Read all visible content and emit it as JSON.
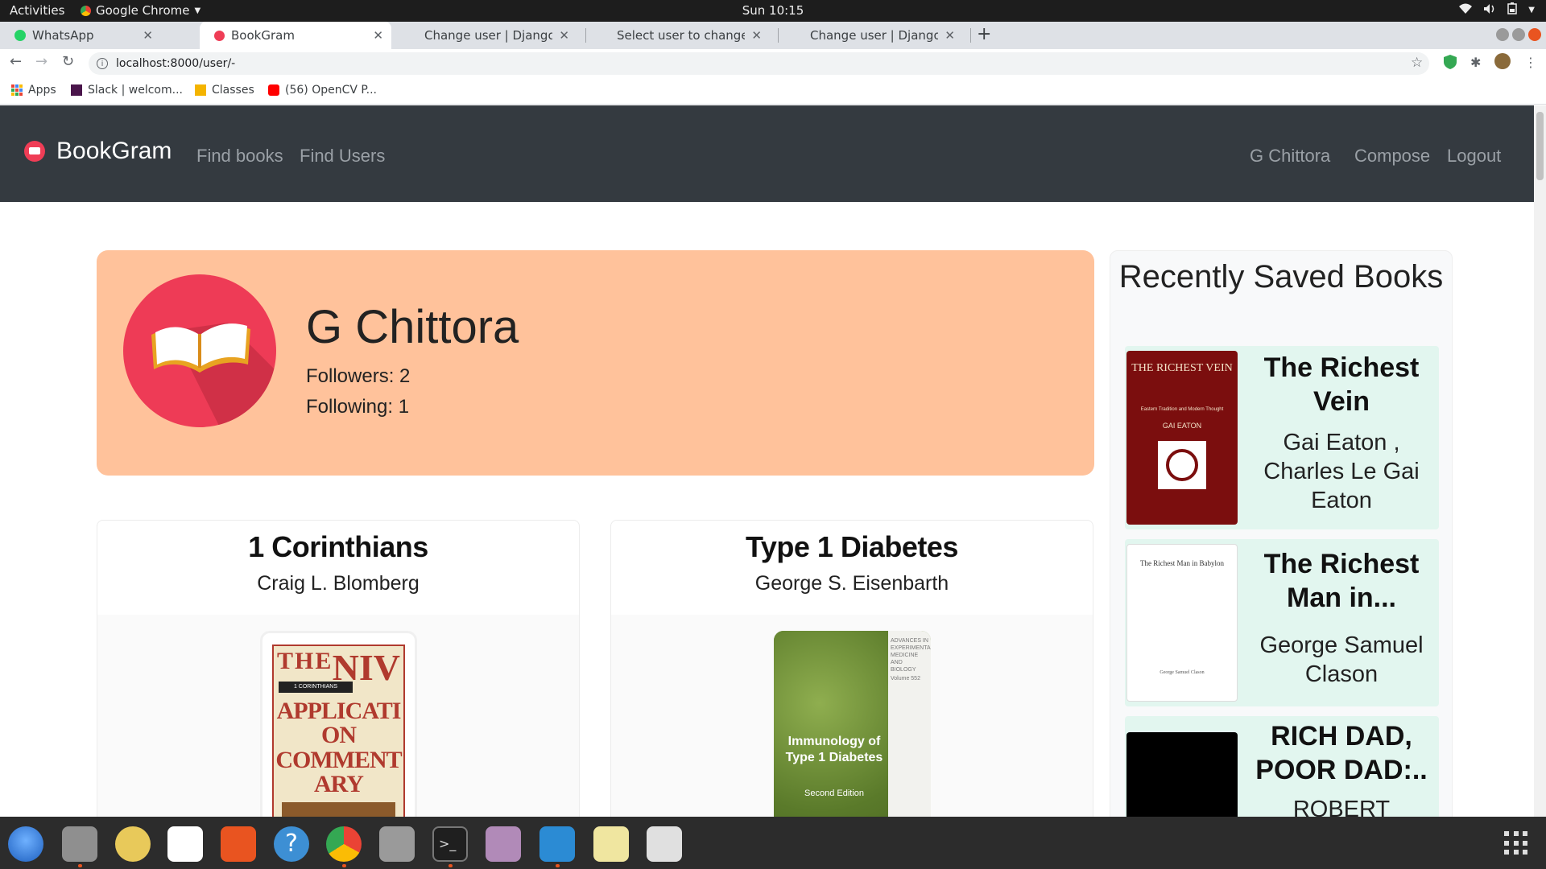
{
  "system": {
    "activities": "Activities",
    "app_name": "Google Chrome",
    "clock": "Sun 10:15"
  },
  "browser": {
    "tabs": [
      {
        "title": "WhatsApp",
        "active": false
      },
      {
        "title": "BookGram",
        "active": true
      },
      {
        "title": "Change user | Django site",
        "active": false
      },
      {
        "title": "Select user to change | Dj",
        "active": false
      },
      {
        "title": "Change user | Django site",
        "active": false
      }
    ],
    "url": "localhost:8000/user/-",
    "bookmarks": [
      "Apps",
      "Slack | welcom...",
      "Classes",
      "(56) OpenCV P..."
    ]
  },
  "navbar": {
    "brand": "BookGram",
    "links": [
      "Find books",
      "Find Users"
    ],
    "right_links": [
      "G Chittora",
      "Compose",
      "Logout"
    ]
  },
  "profile": {
    "name": "G Chittora",
    "followers": "Followers: 2",
    "following": "Following: 1"
  },
  "books": [
    {
      "title": "1 Corinthians",
      "author": "Craig L. Blomberg",
      "cover_icon": "niv-application-commentary-cover",
      "cover_text": [
        "THE",
        "NIV",
        "1 CORINTHIANS",
        "APPLICATION",
        "COMMENTARY"
      ]
    },
    {
      "title": "Type 1 Diabetes",
      "author": "George S. Eisenbarth",
      "cover_icon": "immunology-type1-diabetes-cover",
      "cover_text": [
        "ADVANCES IN EXPERIMENTAL MEDICINE AND BIOLOGY",
        "Volume 552",
        "Immunology of Type 1 Diabetes",
        "Second Edition"
      ]
    }
  ],
  "sidebar": {
    "title": "Recently Saved Books",
    "items": [
      {
        "title": "The Richest Vein",
        "author": "Gai Eaton , Charles Le Gai Eaton",
        "cover_text": [
          "THE RICHEST VEIN",
          "Eastern Tradition and Modern Thought",
          "GAI EATON"
        ]
      },
      {
        "title": "The Richest Man in...",
        "author": "George Samuel Clason",
        "cover_text": [
          "The Richest Man in Babylon",
          "George Samuel Clason"
        ]
      },
      {
        "title": "RICH DAD, POOR DAD:..",
        "author": "ROBERT",
        "cover_text": []
      }
    ]
  },
  "colors": {
    "navbar_bg": "#343a40",
    "profile_bg": "#ffc29b",
    "avatar_bg": "#ee3b56",
    "sidebar_item_bg": "#e2f6ef"
  }
}
